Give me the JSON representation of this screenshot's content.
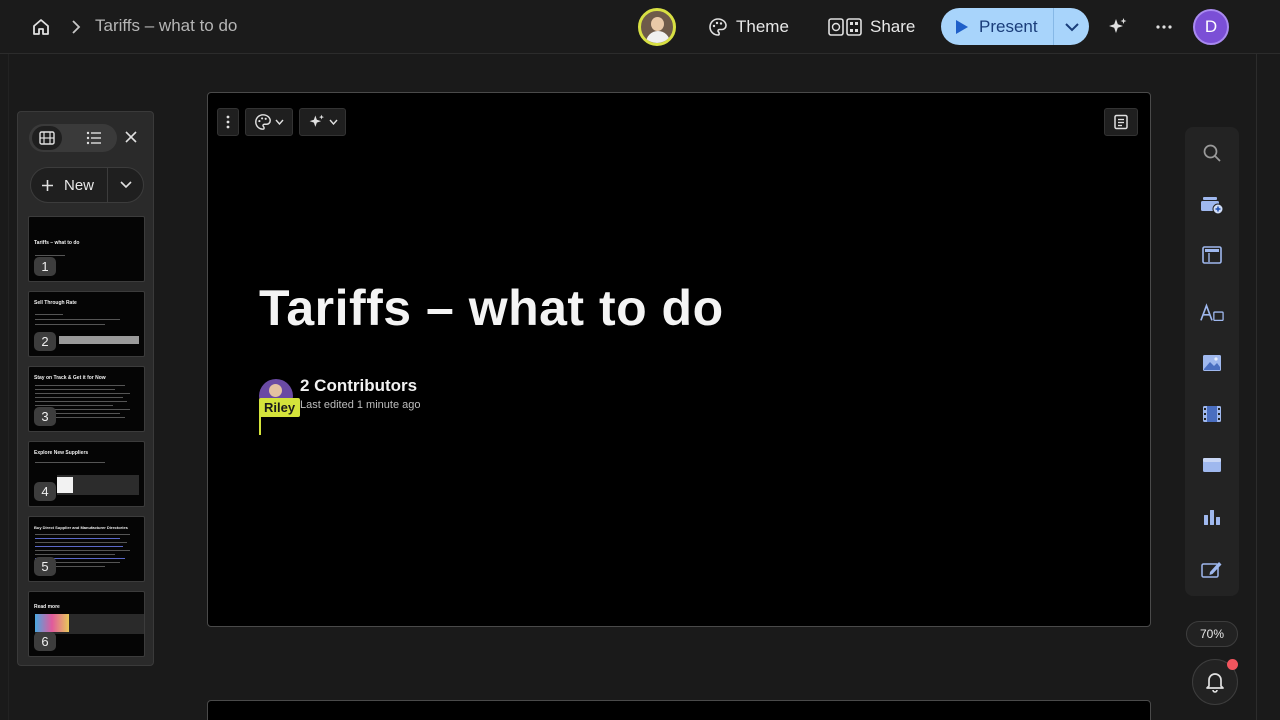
{
  "header": {
    "doc_title": "Tariffs – what to do",
    "theme_label": "Theme",
    "share_label": "Share",
    "present_label": "Present",
    "user_initial": "D"
  },
  "sidebar": {
    "new_label": "New",
    "slides": [
      {
        "number": "1",
        "title": "Tariffs – what to do"
      },
      {
        "number": "2",
        "title": "Sell Through Rate"
      },
      {
        "number": "3",
        "title": "Stay on Track & Get it for Now"
      },
      {
        "number": "4",
        "title": "Explore New Suppliers"
      },
      {
        "number": "5",
        "title": "Buy Direct Supplier and Manufacturer Directories"
      },
      {
        "number": "6",
        "title": "Read more"
      }
    ]
  },
  "slide": {
    "title": "Tariffs – what to do",
    "contributors_label": "2 Contributors",
    "last_edited": "Last edited 1 minute ago",
    "cursor_user": "Riley"
  },
  "zoom": "70%",
  "colors": {
    "accent_present": "#a8d4fb",
    "collaborator_yellow": "#d4e33b",
    "user_avatar": "#7b4fd6",
    "notification_dot": "#f2555e"
  },
  "icons": {
    "right_toolbar": [
      "search-icon",
      "add-card-icon",
      "layout-icon",
      "text-icon",
      "image-icon",
      "video-icon",
      "embed-icon",
      "chart-icon",
      "draw-icon"
    ]
  }
}
